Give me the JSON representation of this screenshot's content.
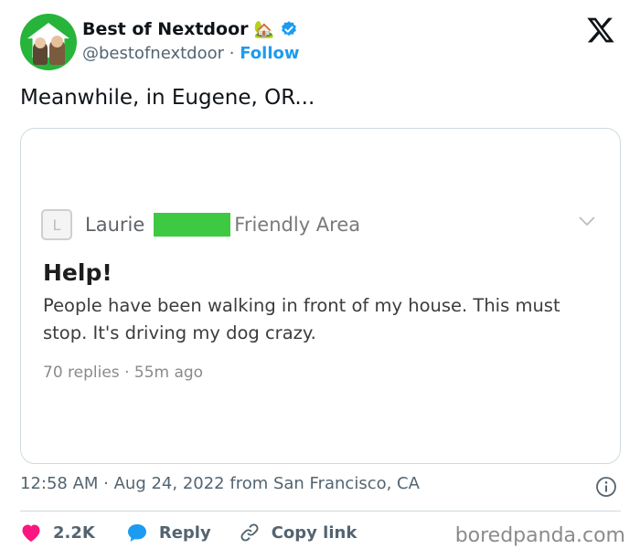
{
  "account": {
    "name": "Best of Nextdoor",
    "emoji": "🏡",
    "handle": "@bestofnextdoor",
    "separator": "·",
    "follow_label": "Follow"
  },
  "tweet": {
    "text": "Meanwhile, in Eugene, OR..."
  },
  "embedded_post": {
    "avatar_letter": "L",
    "author": "Laurie",
    "location": "Friendly Area",
    "title": "Help!",
    "body": "People have been walking in front of my house. This must stop. It's driving my dog crazy.",
    "replies_meta": "70 replies · 55m ago"
  },
  "meta": {
    "timestamp": "12:58 AM · Aug 24, 2022 from San Francisco, CA"
  },
  "actions": {
    "likes": "2.2K",
    "reply_label": "Reply",
    "copy_link_label": "Copy link"
  },
  "watermark": "boredpanda.com",
  "colors": {
    "like": "#f91880",
    "reply": "#1d9bf0",
    "follow": "#1d9bf0",
    "avatar_bg": "#27b43b",
    "redaction": "#3fc943"
  },
  "icons": [
    "verified-badge-icon",
    "x-logo-icon",
    "chevron-down-icon",
    "info-icon",
    "heart-icon",
    "reply-bubble-icon",
    "link-icon"
  ]
}
